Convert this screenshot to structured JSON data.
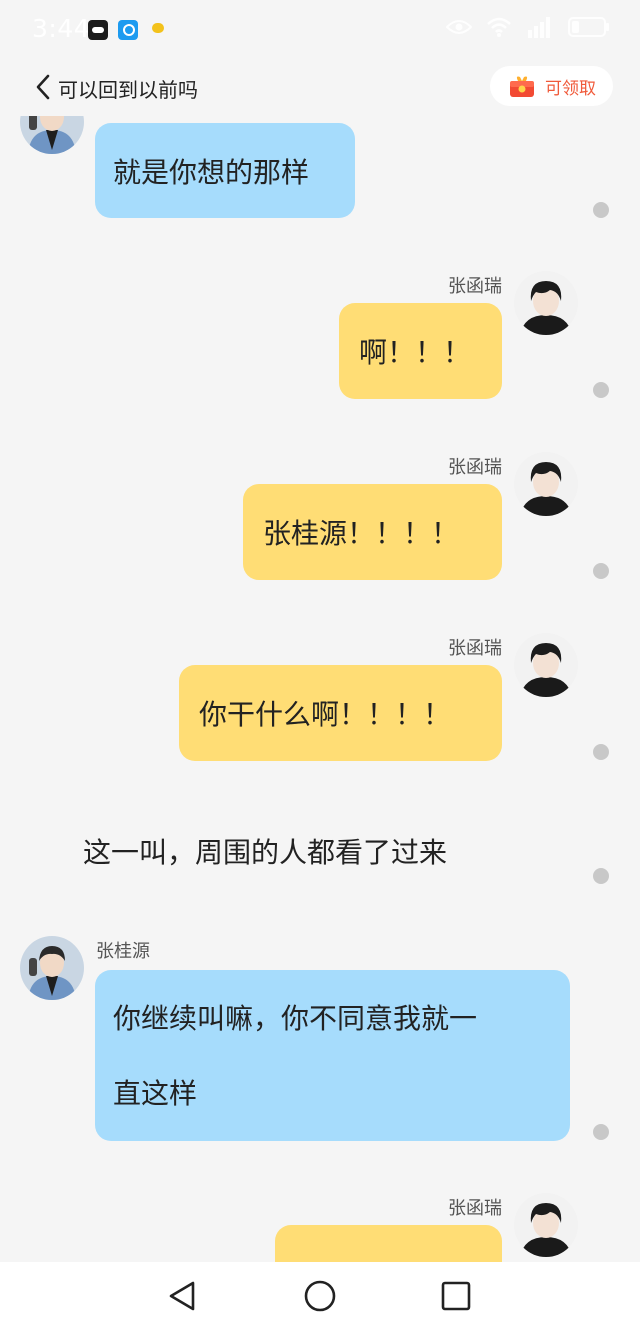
{
  "status_bar": {
    "time": "3:44",
    "icons": [
      "app-icon",
      "search-app-icon",
      "badge-app-icon",
      "eye-icon",
      "wifi-icon",
      "signal-icon",
      "battery-icon"
    ]
  },
  "header": {
    "title": "可以回到以前吗",
    "reward_label": "可领取",
    "accent_color": "#f05a3a"
  },
  "chat": {
    "bubble_colors": {
      "left": "#a6dcfc",
      "right": "#ffdd75"
    },
    "messages": [
      {
        "side": "left",
        "text": "就是你想的那样"
      },
      {
        "side": "right",
        "sender": "张函瑞",
        "text": "啊！！！"
      },
      {
        "side": "right",
        "sender": "张函瑞",
        "text": "张桂源！！！！"
      },
      {
        "side": "right",
        "sender": "张函瑞",
        "text": "你干什么啊！！！！"
      },
      {
        "side": "narration",
        "text": "这一叫，周围的人都看了过来"
      },
      {
        "side": "left",
        "sender": "张桂源",
        "line1": "你继续叫嘛，你不同意我就一",
        "line2": "直这样"
      },
      {
        "side": "right",
        "sender": "张函瑞"
      }
    ]
  },
  "nav_bar": {
    "buttons": [
      "back-triangle-icon",
      "home-circle-icon",
      "recents-square-icon"
    ]
  }
}
